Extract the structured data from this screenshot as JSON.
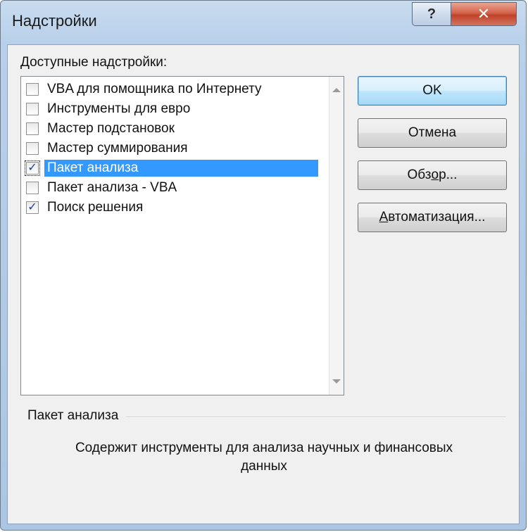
{
  "window": {
    "title": "Надстройки",
    "help_glyph": "?",
    "close_glyph": "✕"
  },
  "addins": {
    "label_prefix": "",
    "label_access_key": "Д",
    "label_rest": "оступные надстройки:",
    "items": [
      {
        "label": "VBA для помощника по Интернету",
        "checked": false,
        "selected": false
      },
      {
        "label": "Инструменты для евро",
        "checked": false,
        "selected": false
      },
      {
        "label": "Мастер подстановок",
        "checked": false,
        "selected": false
      },
      {
        "label": "Мастер суммирования",
        "checked": false,
        "selected": false
      },
      {
        "label": "Пакет анализа",
        "checked": true,
        "selected": true
      },
      {
        "label": "Пакет анализа - VBA",
        "checked": false,
        "selected": false
      },
      {
        "label": "Поиск решения",
        "checked": true,
        "selected": false
      }
    ]
  },
  "buttons": {
    "ok": "OK",
    "cancel": "Отмена",
    "browse_before": "Обз",
    "browse_key": "о",
    "browse_after": "р...",
    "automation_key": "А",
    "automation_after": "втоматизация..."
  },
  "description": {
    "title": "Пакет анализа",
    "text_line1": "Содержит инструменты для анализа научных и финансовых",
    "text_line2": "данных"
  },
  "icons": {
    "check": "✓"
  }
}
